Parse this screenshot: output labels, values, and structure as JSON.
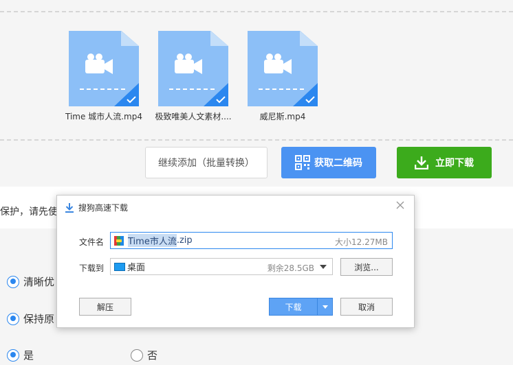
{
  "files": [
    {
      "name": "Time 城市人流.mp4",
      "icon": "video-file-icon",
      "selected": true
    },
    {
      "name": "极致唯美人文素材....",
      "icon": "video-file-icon",
      "selected": true
    },
    {
      "name": "威尼斯.mp4",
      "icon": "video-file-icon",
      "selected": true
    }
  ],
  "actions": {
    "continue_label": "继续添加（批量转换）",
    "qr_label": "获取二维码",
    "download_label": "立即下载"
  },
  "notice_text": "保护，请先使",
  "options": {
    "opt1": "清晰优",
    "opt2": "保持原",
    "yes": "是",
    "no": "否"
  },
  "dialog": {
    "title": "搜狗高速下载",
    "filename_label": "文件名",
    "filename_selected": "Time市人流",
    "filename_ext": ".zip",
    "size_text": "大小12.27MB",
    "saveto_label": "下载到",
    "path_text": "桌面",
    "free_text": "剩余28.5GB",
    "browse_label": "浏览...",
    "extract_label": "解压",
    "download_label": "下载",
    "cancel_label": "取消"
  },
  "colors": {
    "accent_blue": "#4b93f2",
    "download_green": "#3cab1c",
    "thumb_blue": "#8cbff7",
    "check_blue": "#2b87ef"
  }
}
